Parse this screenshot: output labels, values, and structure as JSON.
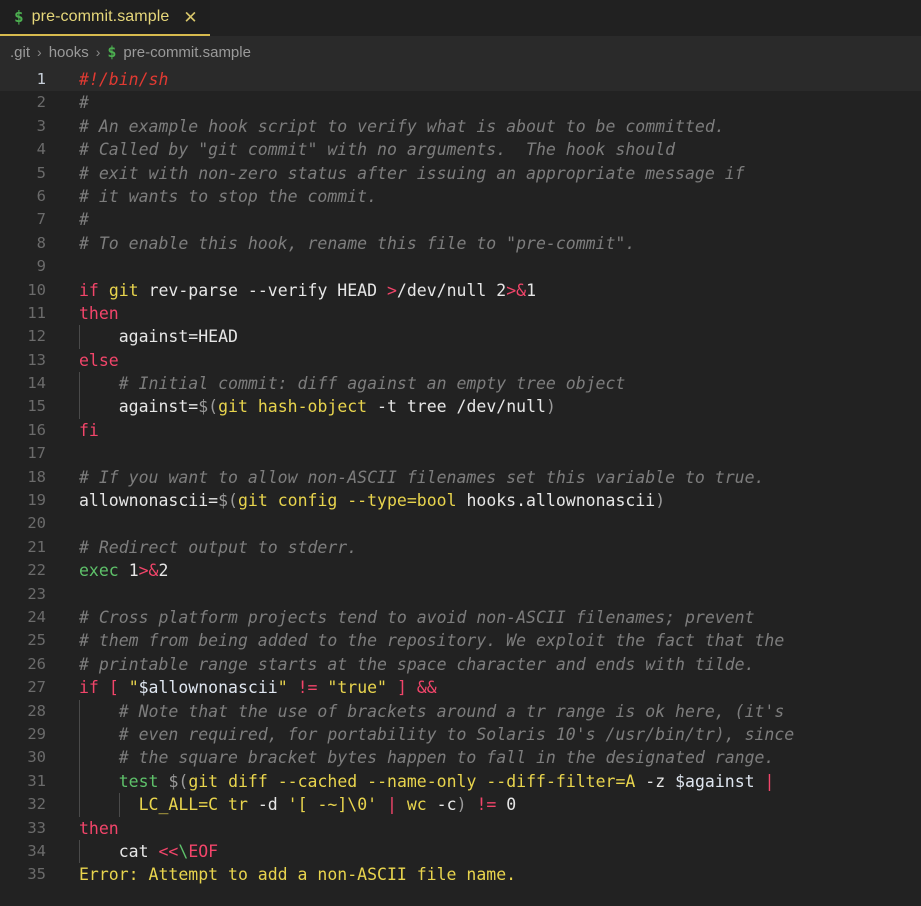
{
  "window": {
    "title": "pre-commit.sample"
  },
  "tab": {
    "icon": "shell-script-icon",
    "icon_glyph": "$",
    "label": "pre-commit.sample",
    "close_glyph": "✕"
  },
  "breadcrumb": {
    "separator": "›",
    "items": [
      {
        "label": ".git"
      },
      {
        "label": "hooks"
      },
      {
        "label": "pre-commit.sample",
        "icon_glyph": "$"
      }
    ]
  },
  "editor": {
    "language": "shellscript",
    "active_line": 1,
    "colors": {
      "background": "#222222",
      "active_line": "#2a2a2a",
      "line_number": "#6b6b6b",
      "active_line_number": "#c8d0da",
      "comment": "#7d7d7d",
      "keyword": "#f2456a",
      "builtin": "#5ec16a",
      "command": "#e8d44d",
      "string": "#e8d44d",
      "variable": "#dfe6f0",
      "shebang": "#e03a32",
      "tab_accent": "#d7ba4e"
    },
    "lines": [
      {
        "n": 1,
        "indent": 0,
        "tokens": [
          {
            "t": "#!/bin/sh",
            "c": "shebang"
          }
        ]
      },
      {
        "n": 2,
        "indent": 0,
        "tokens": [
          {
            "t": "#",
            "c": "comment"
          }
        ]
      },
      {
        "n": 3,
        "indent": 0,
        "tokens": [
          {
            "t": "# An example hook script to verify what is about to be committed.",
            "c": "comment"
          }
        ]
      },
      {
        "n": 4,
        "indent": 0,
        "tokens": [
          {
            "t": "# Called by \"git commit\" with no arguments.  The hook should",
            "c": "comment"
          }
        ]
      },
      {
        "n": 5,
        "indent": 0,
        "tokens": [
          {
            "t": "# exit with non-zero status after issuing an appropriate message if",
            "c": "comment"
          }
        ]
      },
      {
        "n": 6,
        "indent": 0,
        "tokens": [
          {
            "t": "# it wants to stop the commit.",
            "c": "comment"
          }
        ]
      },
      {
        "n": 7,
        "indent": 0,
        "tokens": [
          {
            "t": "#",
            "c": "comment"
          }
        ]
      },
      {
        "n": 8,
        "indent": 0,
        "tokens": [
          {
            "t": "# To enable this hook, rename this file to \"pre-commit\".",
            "c": "comment"
          }
        ]
      },
      {
        "n": 9,
        "indent": 0,
        "tokens": []
      },
      {
        "n": 10,
        "indent": 0,
        "tokens": [
          {
            "t": "if",
            "c": "kw"
          },
          {
            "t": " ",
            "c": "plain"
          },
          {
            "t": "git",
            "c": "cmd"
          },
          {
            "t": " ",
            "c": "plain"
          },
          {
            "t": "rev-parse --verify HEAD ",
            "c": "plain"
          },
          {
            "t": ">",
            "c": "op"
          },
          {
            "t": "/dev/null ",
            "c": "plain"
          },
          {
            "t": "2",
            "c": "num"
          },
          {
            "t": ">&",
            "c": "op"
          },
          {
            "t": "1",
            "c": "num"
          }
        ]
      },
      {
        "n": 11,
        "indent": 0,
        "tokens": [
          {
            "t": "then",
            "c": "kw"
          }
        ]
      },
      {
        "n": 12,
        "indent": 1,
        "tokens": [
          {
            "t": "    against=HEAD",
            "c": "plain"
          }
        ]
      },
      {
        "n": 13,
        "indent": 0,
        "tokens": [
          {
            "t": "else",
            "c": "kw"
          }
        ]
      },
      {
        "n": 14,
        "indent": 1,
        "tokens": [
          {
            "t": "    # Initial commit: diff against an empty tree object",
            "c": "comment"
          }
        ]
      },
      {
        "n": 15,
        "indent": 1,
        "tokens": [
          {
            "t": "    against=",
            "c": "plain"
          },
          {
            "t": "$(",
            "c": "punct"
          },
          {
            "t": "git",
            "c": "cmd"
          },
          {
            "t": " ",
            "c": "plain"
          },
          {
            "t": "hash-object",
            "c": "cmd"
          },
          {
            "t": " -t tree /dev/null",
            "c": "plain"
          },
          {
            "t": ")",
            "c": "punct"
          }
        ]
      },
      {
        "n": 16,
        "indent": 0,
        "tokens": [
          {
            "t": "fi",
            "c": "kw"
          }
        ]
      },
      {
        "n": 17,
        "indent": 0,
        "tokens": []
      },
      {
        "n": 18,
        "indent": 0,
        "tokens": [
          {
            "t": "# If you want to allow non-ASCII filenames set this variable to true.",
            "c": "comment"
          }
        ]
      },
      {
        "n": 19,
        "indent": 0,
        "tokens": [
          {
            "t": "allownonascii=",
            "c": "plain"
          },
          {
            "t": "$(",
            "c": "punct"
          },
          {
            "t": "git",
            "c": "cmd"
          },
          {
            "t": " ",
            "c": "plain"
          },
          {
            "t": "config --type=bool",
            "c": "cmd"
          },
          {
            "t": " hooks.allownonascii",
            "c": "plain"
          },
          {
            "t": ")",
            "c": "punct"
          }
        ]
      },
      {
        "n": 20,
        "indent": 0,
        "tokens": []
      },
      {
        "n": 21,
        "indent": 0,
        "tokens": [
          {
            "t": "# Redirect output to stderr.",
            "c": "comment"
          }
        ]
      },
      {
        "n": 22,
        "indent": 0,
        "tokens": [
          {
            "t": "exec",
            "c": "builtin"
          },
          {
            "t": " ",
            "c": "plain"
          },
          {
            "t": "1",
            "c": "num"
          },
          {
            "t": ">&",
            "c": "op"
          },
          {
            "t": "2",
            "c": "num"
          }
        ]
      },
      {
        "n": 23,
        "indent": 0,
        "tokens": []
      },
      {
        "n": 24,
        "indent": 0,
        "tokens": [
          {
            "t": "# Cross platform projects tend to avoid non-ASCII filenames; prevent",
            "c": "comment"
          }
        ]
      },
      {
        "n": 25,
        "indent": 0,
        "tokens": [
          {
            "t": "# them from being added to the repository. We exploit the fact that the",
            "c": "comment"
          }
        ]
      },
      {
        "n": 26,
        "indent": 0,
        "tokens": [
          {
            "t": "# printable range starts at the space character and ends with tilde.",
            "c": "comment"
          }
        ]
      },
      {
        "n": 27,
        "indent": 0,
        "tokens": [
          {
            "t": "if",
            "c": "kw"
          },
          {
            "t": " ",
            "c": "plain"
          },
          {
            "t": "[",
            "c": "op"
          },
          {
            "t": " ",
            "c": "plain"
          },
          {
            "t": "\"",
            "c": "str"
          },
          {
            "t": "$allownonascii",
            "c": "var"
          },
          {
            "t": "\"",
            "c": "str"
          },
          {
            "t": " ",
            "c": "plain"
          },
          {
            "t": "!=",
            "c": "op"
          },
          {
            "t": " ",
            "c": "plain"
          },
          {
            "t": "\"true\"",
            "c": "str"
          },
          {
            "t": " ",
            "c": "plain"
          },
          {
            "t": "]",
            "c": "op"
          },
          {
            "t": " ",
            "c": "plain"
          },
          {
            "t": "&&",
            "c": "op"
          }
        ]
      },
      {
        "n": 28,
        "indent": 1,
        "tokens": [
          {
            "t": "    # Note that the use of brackets around a tr range is ok here, (it's",
            "c": "comment"
          }
        ]
      },
      {
        "n": 29,
        "indent": 1,
        "tokens": [
          {
            "t": "    # even required, for portability to Solaris 10's /usr/bin/tr), since",
            "c": "comment"
          }
        ]
      },
      {
        "n": 30,
        "indent": 1,
        "tokens": [
          {
            "t": "    # the square bracket bytes happen to fall in the designated range.",
            "c": "comment"
          }
        ]
      },
      {
        "n": 31,
        "indent": 1,
        "tokens": [
          {
            "t": "    ",
            "c": "plain"
          },
          {
            "t": "test",
            "c": "builtin"
          },
          {
            "t": " ",
            "c": "plain"
          },
          {
            "t": "$(",
            "c": "punct"
          },
          {
            "t": "git",
            "c": "cmd"
          },
          {
            "t": " ",
            "c": "plain"
          },
          {
            "t": "diff --cached --name-only --diff-filter=A",
            "c": "cmd"
          },
          {
            "t": " -z ",
            "c": "plain"
          },
          {
            "t": "$against",
            "c": "var"
          },
          {
            "t": " ",
            "c": "plain"
          },
          {
            "t": "|",
            "c": "op"
          }
        ]
      },
      {
        "n": 32,
        "indent": 2,
        "tokens": [
          {
            "t": "      ",
            "c": "plain"
          },
          {
            "t": "LC_ALL=C",
            "c": "cmd"
          },
          {
            "t": " ",
            "c": "plain"
          },
          {
            "t": "tr",
            "c": "cmd"
          },
          {
            "t": " -d ",
            "c": "plain"
          },
          {
            "t": "'[ -~]\\0'",
            "c": "str"
          },
          {
            "t": " ",
            "c": "plain"
          },
          {
            "t": "|",
            "c": "op"
          },
          {
            "t": " ",
            "c": "plain"
          },
          {
            "t": "wc",
            "c": "cmd"
          },
          {
            "t": " -c",
            "c": "plain"
          },
          {
            "t": ")",
            "c": "punct"
          },
          {
            "t": " ",
            "c": "plain"
          },
          {
            "t": "!=",
            "c": "op"
          },
          {
            "t": " ",
            "c": "plain"
          },
          {
            "t": "0",
            "c": "num"
          }
        ]
      },
      {
        "n": 33,
        "indent": 0,
        "tokens": [
          {
            "t": "then",
            "c": "kw"
          }
        ]
      },
      {
        "n": 34,
        "indent": 1,
        "tokens": [
          {
            "t": "    ",
            "c": "plain"
          },
          {
            "t": "cat",
            "c": "plain"
          },
          {
            "t": " ",
            "c": "plain"
          },
          {
            "t": "<<",
            "c": "op"
          },
          {
            "t": "\\",
            "c": "esc"
          },
          {
            "t": "EOF",
            "c": "op"
          }
        ]
      },
      {
        "n": 35,
        "indent": 0,
        "tokens": [
          {
            "t": "Error: Attempt to add a non-ASCII file name.",
            "c": "str"
          }
        ]
      }
    ]
  }
}
